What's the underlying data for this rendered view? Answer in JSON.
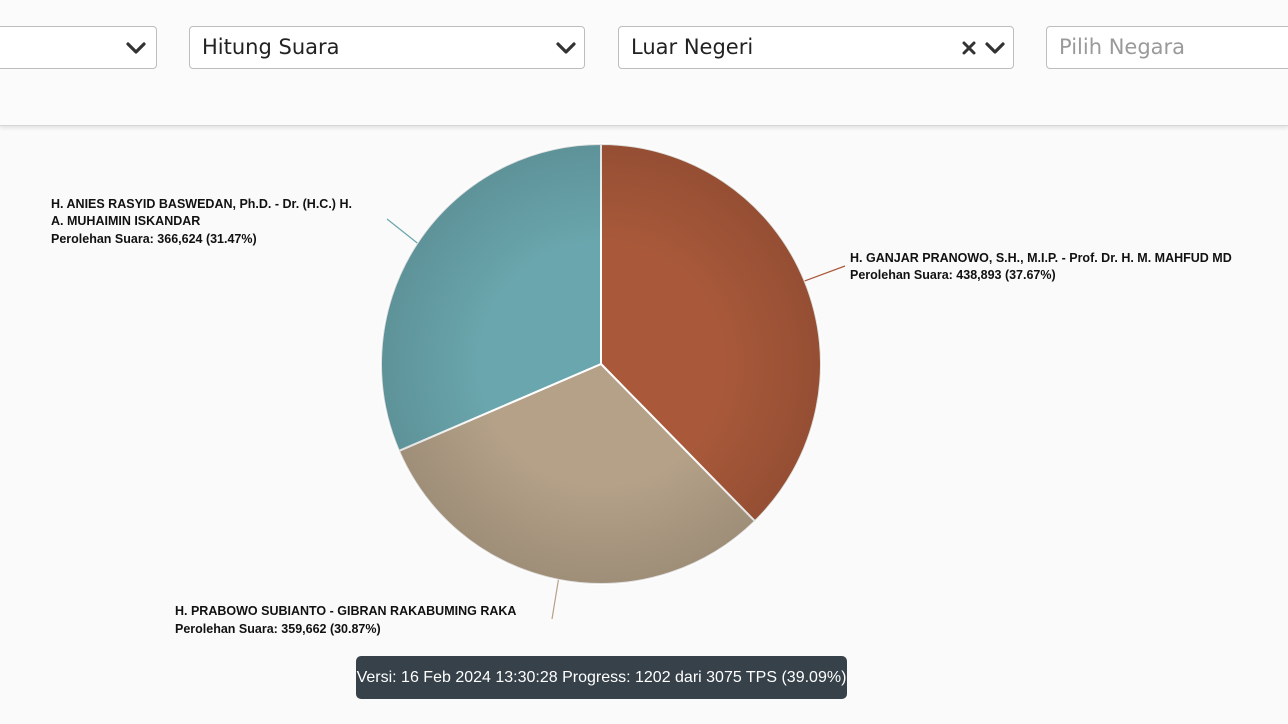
{
  "filters": [
    {
      "value": "",
      "placeholder": "",
      "clearable": false
    },
    {
      "value": "Hitung Suara",
      "placeholder": "",
      "clearable": false
    },
    {
      "value": "Luar Negeri",
      "placeholder": "",
      "clearable": true
    },
    {
      "value": "",
      "placeholder": "Pilih Negara",
      "clearable": false
    }
  ],
  "icons": {
    "dropdown": "chevron-down-icon",
    "clear": "close-icon"
  },
  "chart_data": {
    "type": "pie",
    "slices": [
      {
        "label_line1": "H. GANJAR PRANOWO, S.H., M.I.P. - Prof. Dr. H. M. MAHFUD MD",
        "label_line2": "",
        "value_text": "Perolehan Suara: 438,893 (37.67%)",
        "value": 438893,
        "percent": 37.67,
        "color": "#a9593a"
      },
      {
        "label_line1": "H. PRABOWO SUBIANTO - GIBRAN RAKABUMING RAKA",
        "label_line2": "",
        "value_text": "Perolehan Suara: 359,662 (30.87%)",
        "value": 359662,
        "percent": 30.87,
        "color": "#b4a188"
      },
      {
        "label_line1": "H. ANIES RASYID BASWEDAN, Ph.D. - Dr. (H.C.) H.",
        "label_line2": "A. MUHAIMIN ISKANDAR",
        "value_text": "Perolehan Suara: 366,624 (31.47%)",
        "value": 366624,
        "percent": 31.47,
        "color": "#6aa6ad"
      }
    ],
    "start_angle_deg": 0,
    "direction": "clockwise"
  },
  "status": {
    "text": "Versi: 16 Feb 2024 13:30:28 Progress: 1202 dari 3075 TPS (39.09%)",
    "background": "#36414a"
  }
}
